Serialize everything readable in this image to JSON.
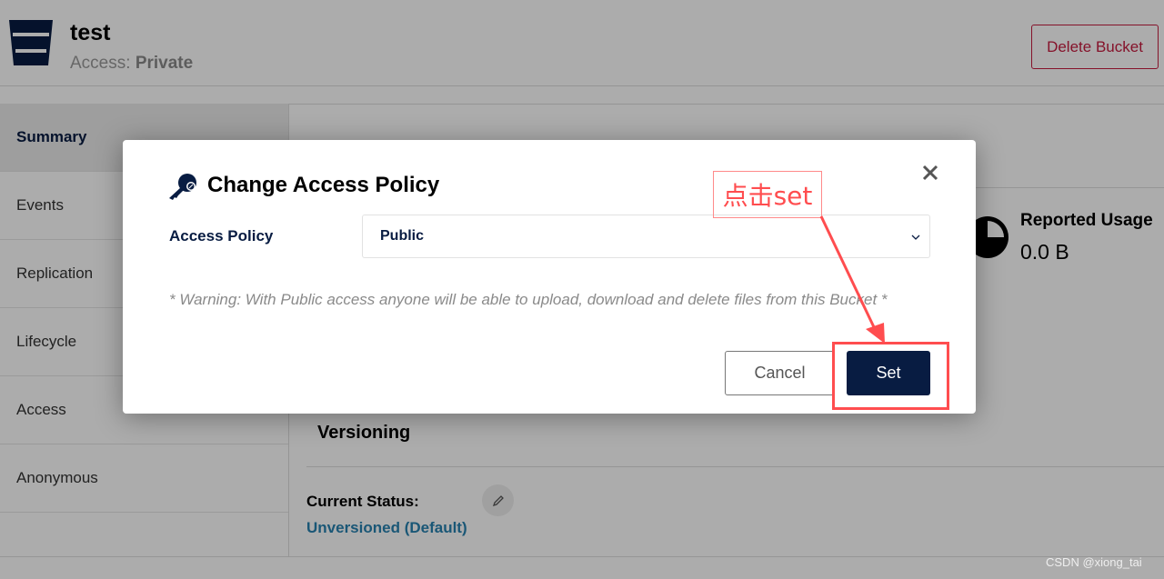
{
  "header": {
    "bucket_name": "test",
    "access_label": "Access:",
    "access_value": "Private",
    "delete_button": "Delete Bucket"
  },
  "sidebar": {
    "items": [
      {
        "label": "Summary",
        "active": true
      },
      {
        "label": "Events"
      },
      {
        "label": "Replication"
      },
      {
        "label": "Lifecycle"
      },
      {
        "label": "Access"
      },
      {
        "label": "Anonymous"
      }
    ]
  },
  "main": {
    "usage_title": "Reported Usage",
    "usage_value": "0.0 B",
    "versioning_title": "Versioning",
    "current_status_label": "Current Status:",
    "current_status_value": "Unversioned (Default)"
  },
  "modal": {
    "title": "Change Access Policy",
    "field_label": "Access Policy",
    "selected_value": "Public",
    "warning": "* Warning: With Public access anyone will be able to upload, download and delete files from this Bucket *",
    "cancel": "Cancel",
    "set": "Set"
  },
  "annotation": {
    "text": "点击set",
    "color": "#ff4d4f"
  },
  "watermark": "CSDN @xiong_tai",
  "colors": {
    "primary": "#081c42",
    "danger": "#c51b3f",
    "link": "#2781b0"
  }
}
